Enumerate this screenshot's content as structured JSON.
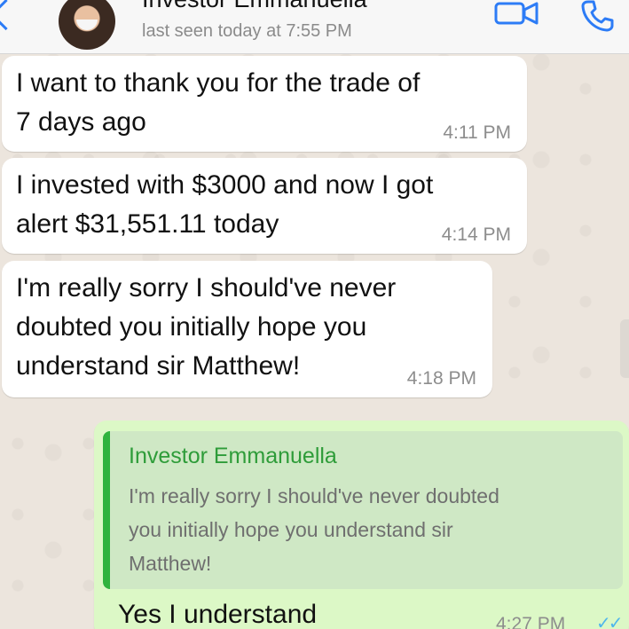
{
  "header": {
    "contact_name": "Investor Emmanuella",
    "status": "last seen today at 7:55 PM",
    "icons": [
      "back-chevron-icon",
      "contact-avatar",
      "video-call-icon",
      "voice-call-icon"
    ],
    "accent_color": "#2d7cf6"
  },
  "messages": [
    {
      "text_lines": [
        "I want to thank you for the trade of",
        "7 days ago"
      ],
      "time": "4:11 PM"
    },
    {
      "text_lines": [
        "I invested with $3000 and now I got",
        "alert $31,551.11 today"
      ],
      "time": "4:14 PM"
    },
    {
      "text_lines": [
        "I'm really sorry I should've never",
        "doubted you initially hope you",
        "understand sir Matthew!"
      ],
      "time": "4:18 PM"
    }
  ],
  "reply": {
    "quote_name": "Investor Emmanuella",
    "quote_lines": [
      "I'm really sorry I should've never doubted",
      "you initially hope you understand sir",
      "Matthew!"
    ],
    "text": "Yes I understand",
    "time": "4:27 PM",
    "status_icon": "double-check-icon",
    "status_text": "✓✓"
  },
  "colors": {
    "incoming_bubble": "#ffffff",
    "outgoing_bubble": "#dcf8c6",
    "quote_accent": "#2fb33d",
    "read_receipt": "#4fb6ec"
  }
}
